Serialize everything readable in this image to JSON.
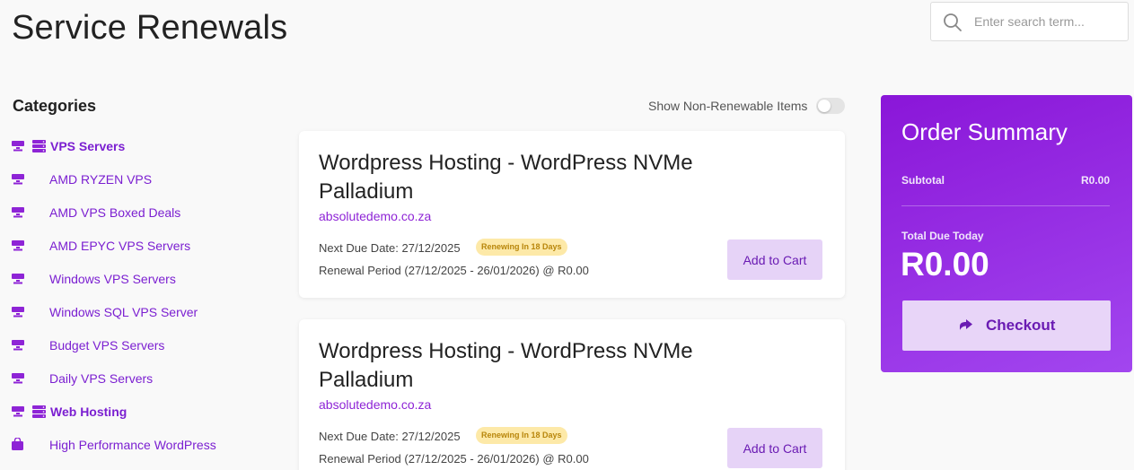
{
  "header": {
    "title": "Service Renewals",
    "search_placeholder": "Enter search term...",
    "search_value": ""
  },
  "sidebar": {
    "heading": "Categories",
    "items": [
      {
        "label": "VPS Servers",
        "type": "group",
        "icon": "server-icon"
      },
      {
        "label": "AMD RYZEN VPS",
        "type": "sub",
        "icon": "server-icon"
      },
      {
        "label": "AMD VPS Boxed Deals",
        "type": "sub",
        "icon": "server-icon"
      },
      {
        "label": "AMD EPYC VPS Servers",
        "type": "sub",
        "icon": "server-icon"
      },
      {
        "label": "Windows VPS Servers",
        "type": "sub",
        "icon": "server-icon"
      },
      {
        "label": "Windows SQL VPS Server",
        "type": "sub",
        "icon": "server-icon"
      },
      {
        "label": "Budget VPS Servers",
        "type": "sub",
        "icon": "server-icon"
      },
      {
        "label": "Daily VPS Servers",
        "type": "sub",
        "icon": "server-icon"
      },
      {
        "label": "Web Hosting",
        "type": "group",
        "icon": "server-icon"
      },
      {
        "label": "High Performance WordPress",
        "type": "sub",
        "icon": "shopping-bag-icon"
      }
    ]
  },
  "toggle": {
    "label": "Show Non-Renewable Items",
    "enabled": false
  },
  "renewals": [
    {
      "title": "Wordpress Hosting - WordPress NVMe Palladium",
      "domain": "absolutedemo.co.za",
      "due_date": "Next Due Date: 27/12/2025",
      "badge": "Renewing In 18 Days",
      "period": "Renewal Period (27/12/2025 - 26/01/2026) @ R0.00",
      "button": "Add to Cart"
    },
    {
      "title": "Wordpress Hosting - WordPress NVMe Palladium",
      "domain": "absolutedemo.co.za",
      "due_date": "Next Due Date: 27/12/2025",
      "badge": "Renewing In 18 Days",
      "period": "Renewal Period (27/12/2025 - 26/01/2026) @ R0.00",
      "button": "Add to Cart"
    }
  ],
  "summary": {
    "title": "Order Summary",
    "subtotal_label": "Subtotal",
    "subtotal_value": "R0.00",
    "total_label": "Total Due Today",
    "total_value": "R0.00",
    "checkout_label": "Checkout"
  },
  "colors": {
    "accent": "#8e24d6",
    "summary_bg": "#9a30e6",
    "badge_bg": "#fde9a8"
  }
}
